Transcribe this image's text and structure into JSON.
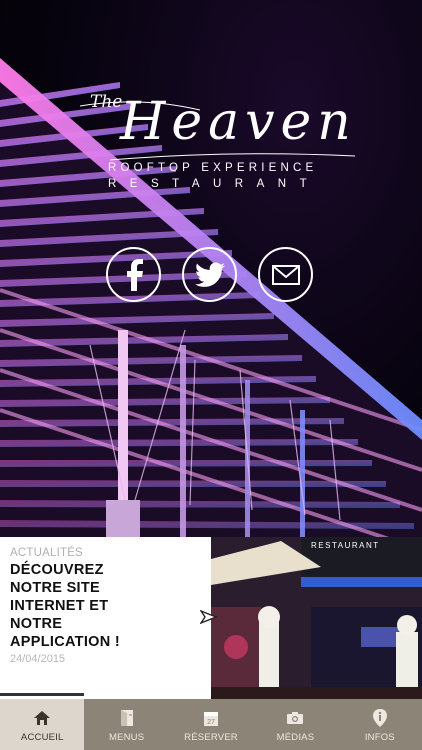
{
  "brand": {
    "the": "The",
    "name": "Heaven",
    "tagline_1": "ROOFTOP EXPERIENCE",
    "tagline_2": "RESTAURANT"
  },
  "social": [
    {
      "icon": "facebook-icon"
    },
    {
      "icon": "twitter-icon"
    },
    {
      "icon": "mail-icon"
    }
  ],
  "news": {
    "kicker": "ACTUALITÉS",
    "headline_lines": [
      "DÉCOUVREZ",
      "NOTRE SITE",
      "INTERNET ET",
      "NOTRE",
      "APPLICATION !"
    ],
    "date": "24/04/2015",
    "photo_sign": "RESTAURANT"
  },
  "tabs": [
    {
      "label": "ACCUEIL",
      "icon": "home-icon",
      "active": true
    },
    {
      "label": "MENUS",
      "icon": "menu-book-icon",
      "active": false
    },
    {
      "label": "RÉSERVER",
      "icon": "calendar-icon",
      "calendar_day": "27",
      "active": false
    },
    {
      "label": "MÉDIAS",
      "icon": "camera-icon",
      "active": false
    },
    {
      "label": "INFOS",
      "icon": "info-pin-icon",
      "active": false
    }
  ],
  "colors": {
    "tabbar": "#8d8478",
    "tab_active": "#ddd6cc",
    "accent_pink": "#e24bd6",
    "accent_blue": "#4f7dff"
  }
}
